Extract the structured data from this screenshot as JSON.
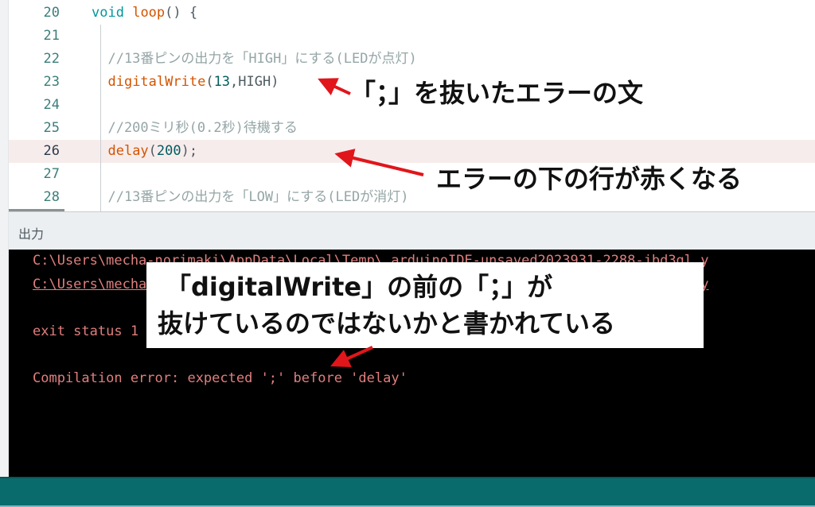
{
  "editor": {
    "lines": [
      {
        "number": "20",
        "tokens": [
          {
            "t": "void",
            "c": "kw"
          },
          {
            "t": " "
          },
          {
            "t": "loop",
            "c": "fn"
          },
          {
            "t": "() {"
          }
        ]
      },
      {
        "number": "21",
        "tokens": []
      },
      {
        "number": "22",
        "tokens": [
          {
            "t": "  //13番ピンの出力を「HIGH」にする(LEDが点灯)",
            "c": "cmt"
          }
        ]
      },
      {
        "number": "23",
        "tokens": [
          {
            "t": "  "
          },
          {
            "t": "digitalWrite",
            "c": "fn"
          },
          {
            "t": "("
          },
          {
            "t": "13",
            "c": "num"
          },
          {
            "t": ",HIGH)"
          }
        ]
      },
      {
        "number": "24",
        "tokens": []
      },
      {
        "number": "25",
        "tokens": [
          {
            "t": "  //200ミリ秒(0.2秒)待機する",
            "c": "cmt"
          }
        ]
      },
      {
        "number": "26",
        "tokens": [
          {
            "t": "  "
          },
          {
            "t": "delay",
            "c": "fn"
          },
          {
            "t": "("
          },
          {
            "t": "200",
            "c": "num"
          },
          {
            "t": ");"
          }
        ],
        "error": true
      },
      {
        "number": "27",
        "tokens": []
      },
      {
        "number": "28",
        "tokens": [
          {
            "t": "  //13番ピンの出力を「LOW」にする(LEDが消灯)",
            "c": "cmt"
          }
        ]
      }
    ]
  },
  "output": {
    "title": "出力",
    "lines": [
      {
        "text": "C:\\Users\\mecha-norimaki\\AppData\\Local\\Temp\\.arduinoIDE-unsaved2023931-2288-jbd3gl.y",
        "link": false
      },
      {
        "text": "C:\\Users\\mecha-norimaki\\AppData\\Local\\Temp\\.arduinoIDE-unsaved2023931-2288-jbd3gl.y",
        "link": true
      },
      {
        "text": "",
        "link": false
      },
      {
        "text": "exit status 1",
        "link": false
      },
      {
        "text": "",
        "link": false
      },
      {
        "text": "Compilation error: expected ';' before 'delay'",
        "link": false
      }
    ]
  },
  "annotations": {
    "missing_semicolon": "「；」を抜いたエラーの文",
    "red_line": "エラーの下の行が赤くなる",
    "explanation_line1": "「digitalWrite」の前の「；」が",
    "explanation_line2": "抜けているのではないかと書かれている",
    "arrow_color": "#e0161b"
  },
  "colors": {
    "status_bar": "#0a6b6c",
    "error_line_bg": "#f7ecec",
    "console_text": "#e07e7e"
  }
}
